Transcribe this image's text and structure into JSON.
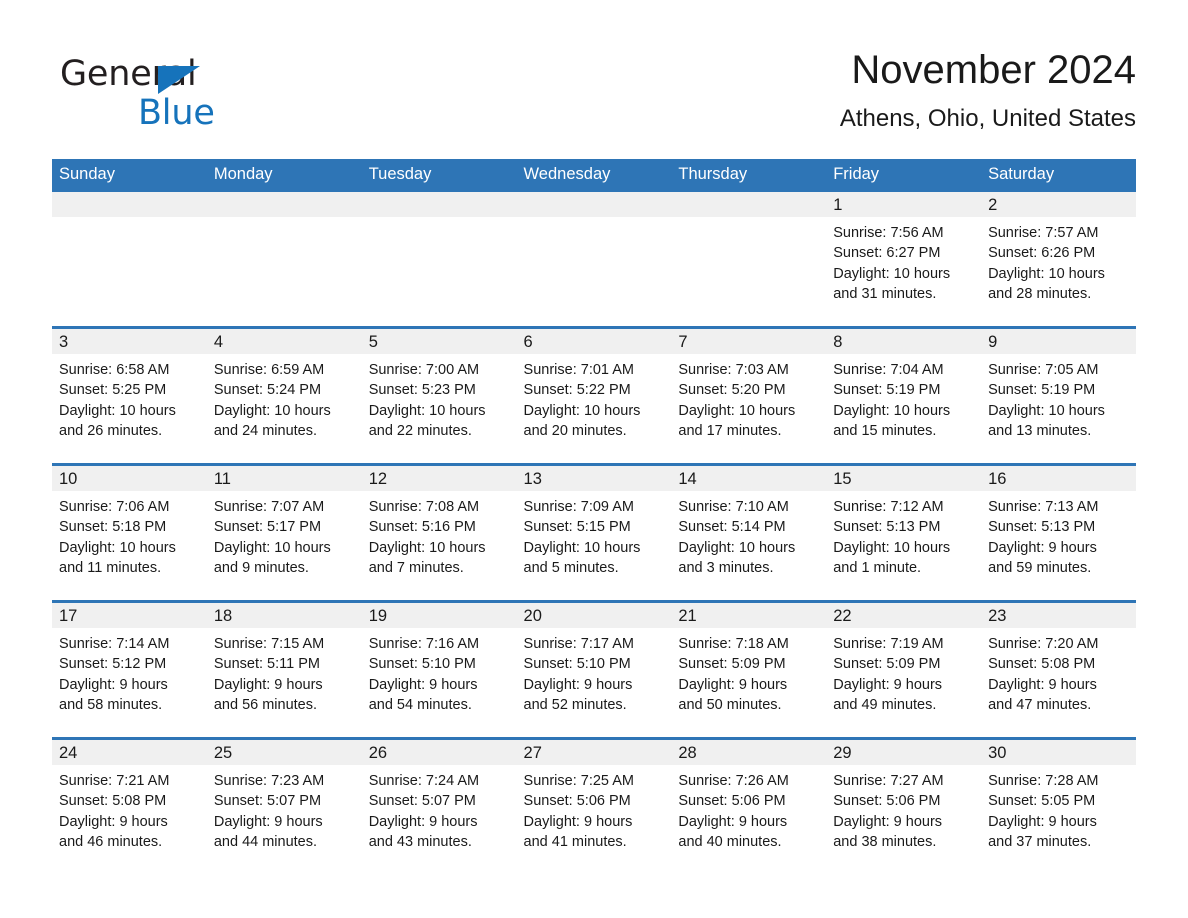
{
  "brand": {
    "line1": "General",
    "line2": "Blue",
    "triangle_icon": "brand-triangle-icon",
    "accent_color": "#1673bb"
  },
  "header": {
    "month_title": "November 2024",
    "location": "Athens, Ohio, United States"
  },
  "theme": {
    "header_blue": "#2e75b6",
    "daynum_band": "#f0f0f0",
    "text": "#1a1a1a"
  },
  "weekday_headers": [
    "Sunday",
    "Monday",
    "Tuesday",
    "Wednesday",
    "Thursday",
    "Friday",
    "Saturday"
  ],
  "weeks": [
    [
      {
        "day": "",
        "lines": []
      },
      {
        "day": "",
        "lines": []
      },
      {
        "day": "",
        "lines": []
      },
      {
        "day": "",
        "lines": []
      },
      {
        "day": "",
        "lines": []
      },
      {
        "day": "1",
        "lines": [
          "Sunrise: 7:56 AM",
          "Sunset: 6:27 PM",
          "Daylight: 10 hours",
          "and 31 minutes."
        ]
      },
      {
        "day": "2",
        "lines": [
          "Sunrise: 7:57 AM",
          "Sunset: 6:26 PM",
          "Daylight: 10 hours",
          "and 28 minutes."
        ]
      }
    ],
    [
      {
        "day": "3",
        "lines": [
          "Sunrise: 6:58 AM",
          "Sunset: 5:25 PM",
          "Daylight: 10 hours",
          "and 26 minutes."
        ]
      },
      {
        "day": "4",
        "lines": [
          "Sunrise: 6:59 AM",
          "Sunset: 5:24 PM",
          "Daylight: 10 hours",
          "and 24 minutes."
        ]
      },
      {
        "day": "5",
        "lines": [
          "Sunrise: 7:00 AM",
          "Sunset: 5:23 PM",
          "Daylight: 10 hours",
          "and 22 minutes."
        ]
      },
      {
        "day": "6",
        "lines": [
          "Sunrise: 7:01 AM",
          "Sunset: 5:22 PM",
          "Daylight: 10 hours",
          "and 20 minutes."
        ]
      },
      {
        "day": "7",
        "lines": [
          "Sunrise: 7:03 AM",
          "Sunset: 5:20 PM",
          "Daylight: 10 hours",
          "and 17 minutes."
        ]
      },
      {
        "day": "8",
        "lines": [
          "Sunrise: 7:04 AM",
          "Sunset: 5:19 PM",
          "Daylight: 10 hours",
          "and 15 minutes."
        ]
      },
      {
        "day": "9",
        "lines": [
          "Sunrise: 7:05 AM",
          "Sunset: 5:19 PM",
          "Daylight: 10 hours",
          "and 13 minutes."
        ]
      }
    ],
    [
      {
        "day": "10",
        "lines": [
          "Sunrise: 7:06 AM",
          "Sunset: 5:18 PM",
          "Daylight: 10 hours",
          "and 11 minutes."
        ]
      },
      {
        "day": "11",
        "lines": [
          "Sunrise: 7:07 AM",
          "Sunset: 5:17 PM",
          "Daylight: 10 hours",
          "and 9 minutes."
        ]
      },
      {
        "day": "12",
        "lines": [
          "Sunrise: 7:08 AM",
          "Sunset: 5:16 PM",
          "Daylight: 10 hours",
          "and 7 minutes."
        ]
      },
      {
        "day": "13",
        "lines": [
          "Sunrise: 7:09 AM",
          "Sunset: 5:15 PM",
          "Daylight: 10 hours",
          "and 5 minutes."
        ]
      },
      {
        "day": "14",
        "lines": [
          "Sunrise: 7:10 AM",
          "Sunset: 5:14 PM",
          "Daylight: 10 hours",
          "and 3 minutes."
        ]
      },
      {
        "day": "15",
        "lines": [
          "Sunrise: 7:12 AM",
          "Sunset: 5:13 PM",
          "Daylight: 10 hours",
          "and 1 minute."
        ]
      },
      {
        "day": "16",
        "lines": [
          "Sunrise: 7:13 AM",
          "Sunset: 5:13 PM",
          "Daylight: 9 hours",
          "and 59 minutes."
        ]
      }
    ],
    [
      {
        "day": "17",
        "lines": [
          "Sunrise: 7:14 AM",
          "Sunset: 5:12 PM",
          "Daylight: 9 hours",
          "and 58 minutes."
        ]
      },
      {
        "day": "18",
        "lines": [
          "Sunrise: 7:15 AM",
          "Sunset: 5:11 PM",
          "Daylight: 9 hours",
          "and 56 minutes."
        ]
      },
      {
        "day": "19",
        "lines": [
          "Sunrise: 7:16 AM",
          "Sunset: 5:10 PM",
          "Daylight: 9 hours",
          "and 54 minutes."
        ]
      },
      {
        "day": "20",
        "lines": [
          "Sunrise: 7:17 AM",
          "Sunset: 5:10 PM",
          "Daylight: 9 hours",
          "and 52 minutes."
        ]
      },
      {
        "day": "21",
        "lines": [
          "Sunrise: 7:18 AM",
          "Sunset: 5:09 PM",
          "Daylight: 9 hours",
          "and 50 minutes."
        ]
      },
      {
        "day": "22",
        "lines": [
          "Sunrise: 7:19 AM",
          "Sunset: 5:09 PM",
          "Daylight: 9 hours",
          "and 49 minutes."
        ]
      },
      {
        "day": "23",
        "lines": [
          "Sunrise: 7:20 AM",
          "Sunset: 5:08 PM",
          "Daylight: 9 hours",
          "and 47 minutes."
        ]
      }
    ],
    [
      {
        "day": "24",
        "lines": [
          "Sunrise: 7:21 AM",
          "Sunset: 5:08 PM",
          "Daylight: 9 hours",
          "and 46 minutes."
        ]
      },
      {
        "day": "25",
        "lines": [
          "Sunrise: 7:23 AM",
          "Sunset: 5:07 PM",
          "Daylight: 9 hours",
          "and 44 minutes."
        ]
      },
      {
        "day": "26",
        "lines": [
          "Sunrise: 7:24 AM",
          "Sunset: 5:07 PM",
          "Daylight: 9 hours",
          "and 43 minutes."
        ]
      },
      {
        "day": "27",
        "lines": [
          "Sunrise: 7:25 AM",
          "Sunset: 5:06 PM",
          "Daylight: 9 hours",
          "and 41 minutes."
        ]
      },
      {
        "day": "28",
        "lines": [
          "Sunrise: 7:26 AM",
          "Sunset: 5:06 PM",
          "Daylight: 9 hours",
          "and 40 minutes."
        ]
      },
      {
        "day": "29",
        "lines": [
          "Sunrise: 7:27 AM",
          "Sunset: 5:06 PM",
          "Daylight: 9 hours",
          "and 38 minutes."
        ]
      },
      {
        "day": "30",
        "lines": [
          "Sunrise: 7:28 AM",
          "Sunset: 5:05 PM",
          "Daylight: 9 hours",
          "and 37 minutes."
        ]
      }
    ]
  ]
}
